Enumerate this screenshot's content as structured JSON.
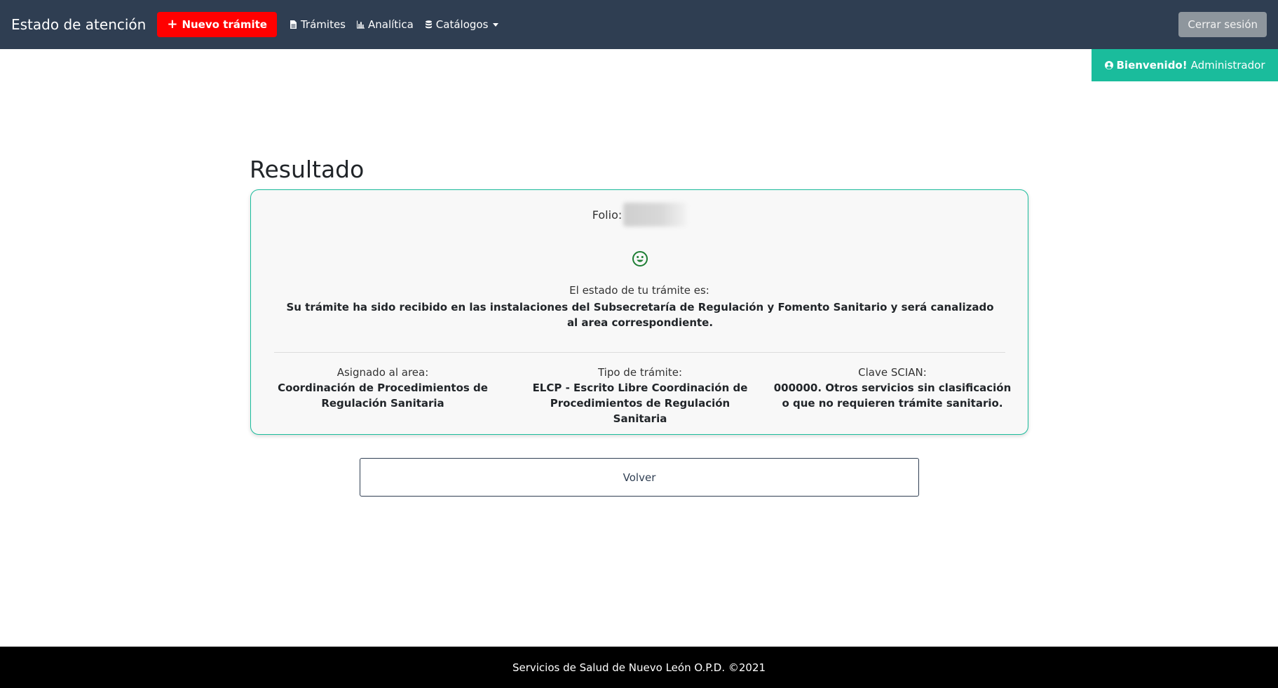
{
  "navbar": {
    "brand": "Estado de atención",
    "new_button": "Nuevo trámite",
    "links": {
      "tramites": "Trámites",
      "analitica": "Analítica",
      "catalogos": "Catálogos"
    },
    "logout": "Cerrar sesión",
    "colors": {
      "background": "#2f3e52",
      "new_button": "#ff0000",
      "logout": "#8e969d"
    }
  },
  "welcome": {
    "greeting": "Bienvenido!",
    "user": "Administrador",
    "color": "#1abc9c"
  },
  "main": {
    "title": "Resultado",
    "folio_label": "Folio:",
    "status_icon": "smile-icon",
    "estado_label": "El estado de tu trámite es:",
    "estado_value": "Su trámite ha sido recibido en las instalaciones del Subsecretaría de Regulación y Fomento Sanitario y será canalizado al area correspondiente.",
    "details": [
      {
        "label": "Asignado al area:",
        "value": "Coordinación de Procedimientos de Regulación Sanitaria"
      },
      {
        "label": "Tipo de trámite:",
        "value": "ELCP - Escrito Libre Coordinación de Procedimientos de Regulación Sanitaria"
      },
      {
        "label": "Clave SCIAN:",
        "value": "000000. Otros servicios sin clasificación o que no requieren trámite sanitario."
      }
    ],
    "back_button": "Volver"
  },
  "footer": {
    "text": "Servicios de Salud de Nuevo León O.P.D. ©2021"
  }
}
